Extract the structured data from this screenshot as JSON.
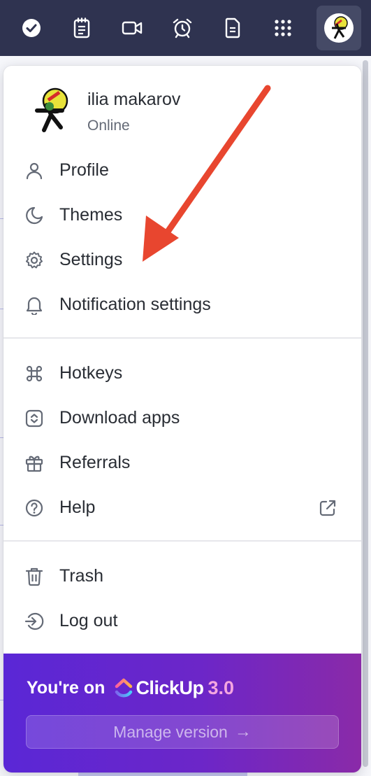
{
  "topbar": {
    "icons": [
      "check-circle-icon",
      "notepad-icon",
      "video-icon",
      "alarm-icon",
      "document-icon",
      "apps-grid-icon",
      "avatar"
    ]
  },
  "user": {
    "name": "ilia makarov",
    "status": "Online"
  },
  "menu": {
    "group1": [
      {
        "label": "Profile",
        "icon": "user-icon"
      },
      {
        "label": "Themes",
        "icon": "moon-icon"
      },
      {
        "label": "Settings",
        "icon": "gear-icon"
      },
      {
        "label": "Notification settings",
        "icon": "bell-icon"
      }
    ],
    "group2": [
      {
        "label": "Hotkeys",
        "icon": "command-icon"
      },
      {
        "label": "Download apps",
        "icon": "download-apps-icon"
      },
      {
        "label": "Referrals",
        "icon": "gift-icon"
      },
      {
        "label": "Help",
        "icon": "help-icon"
      }
    ],
    "group3": [
      {
        "label": "Trash",
        "icon": "trash-icon"
      },
      {
        "label": "Log out",
        "icon": "logout-icon"
      }
    ]
  },
  "promo": {
    "text": "You're on",
    "brand": "ClickUp",
    "version": "3.0",
    "button_label": "Manage version",
    "button_arrow": "→"
  },
  "colors": {
    "topbar": "#2f3350",
    "annotation_arrow": "#e8462f",
    "promo_start": "#5a27d6",
    "promo_end": "#8a2aa8"
  }
}
